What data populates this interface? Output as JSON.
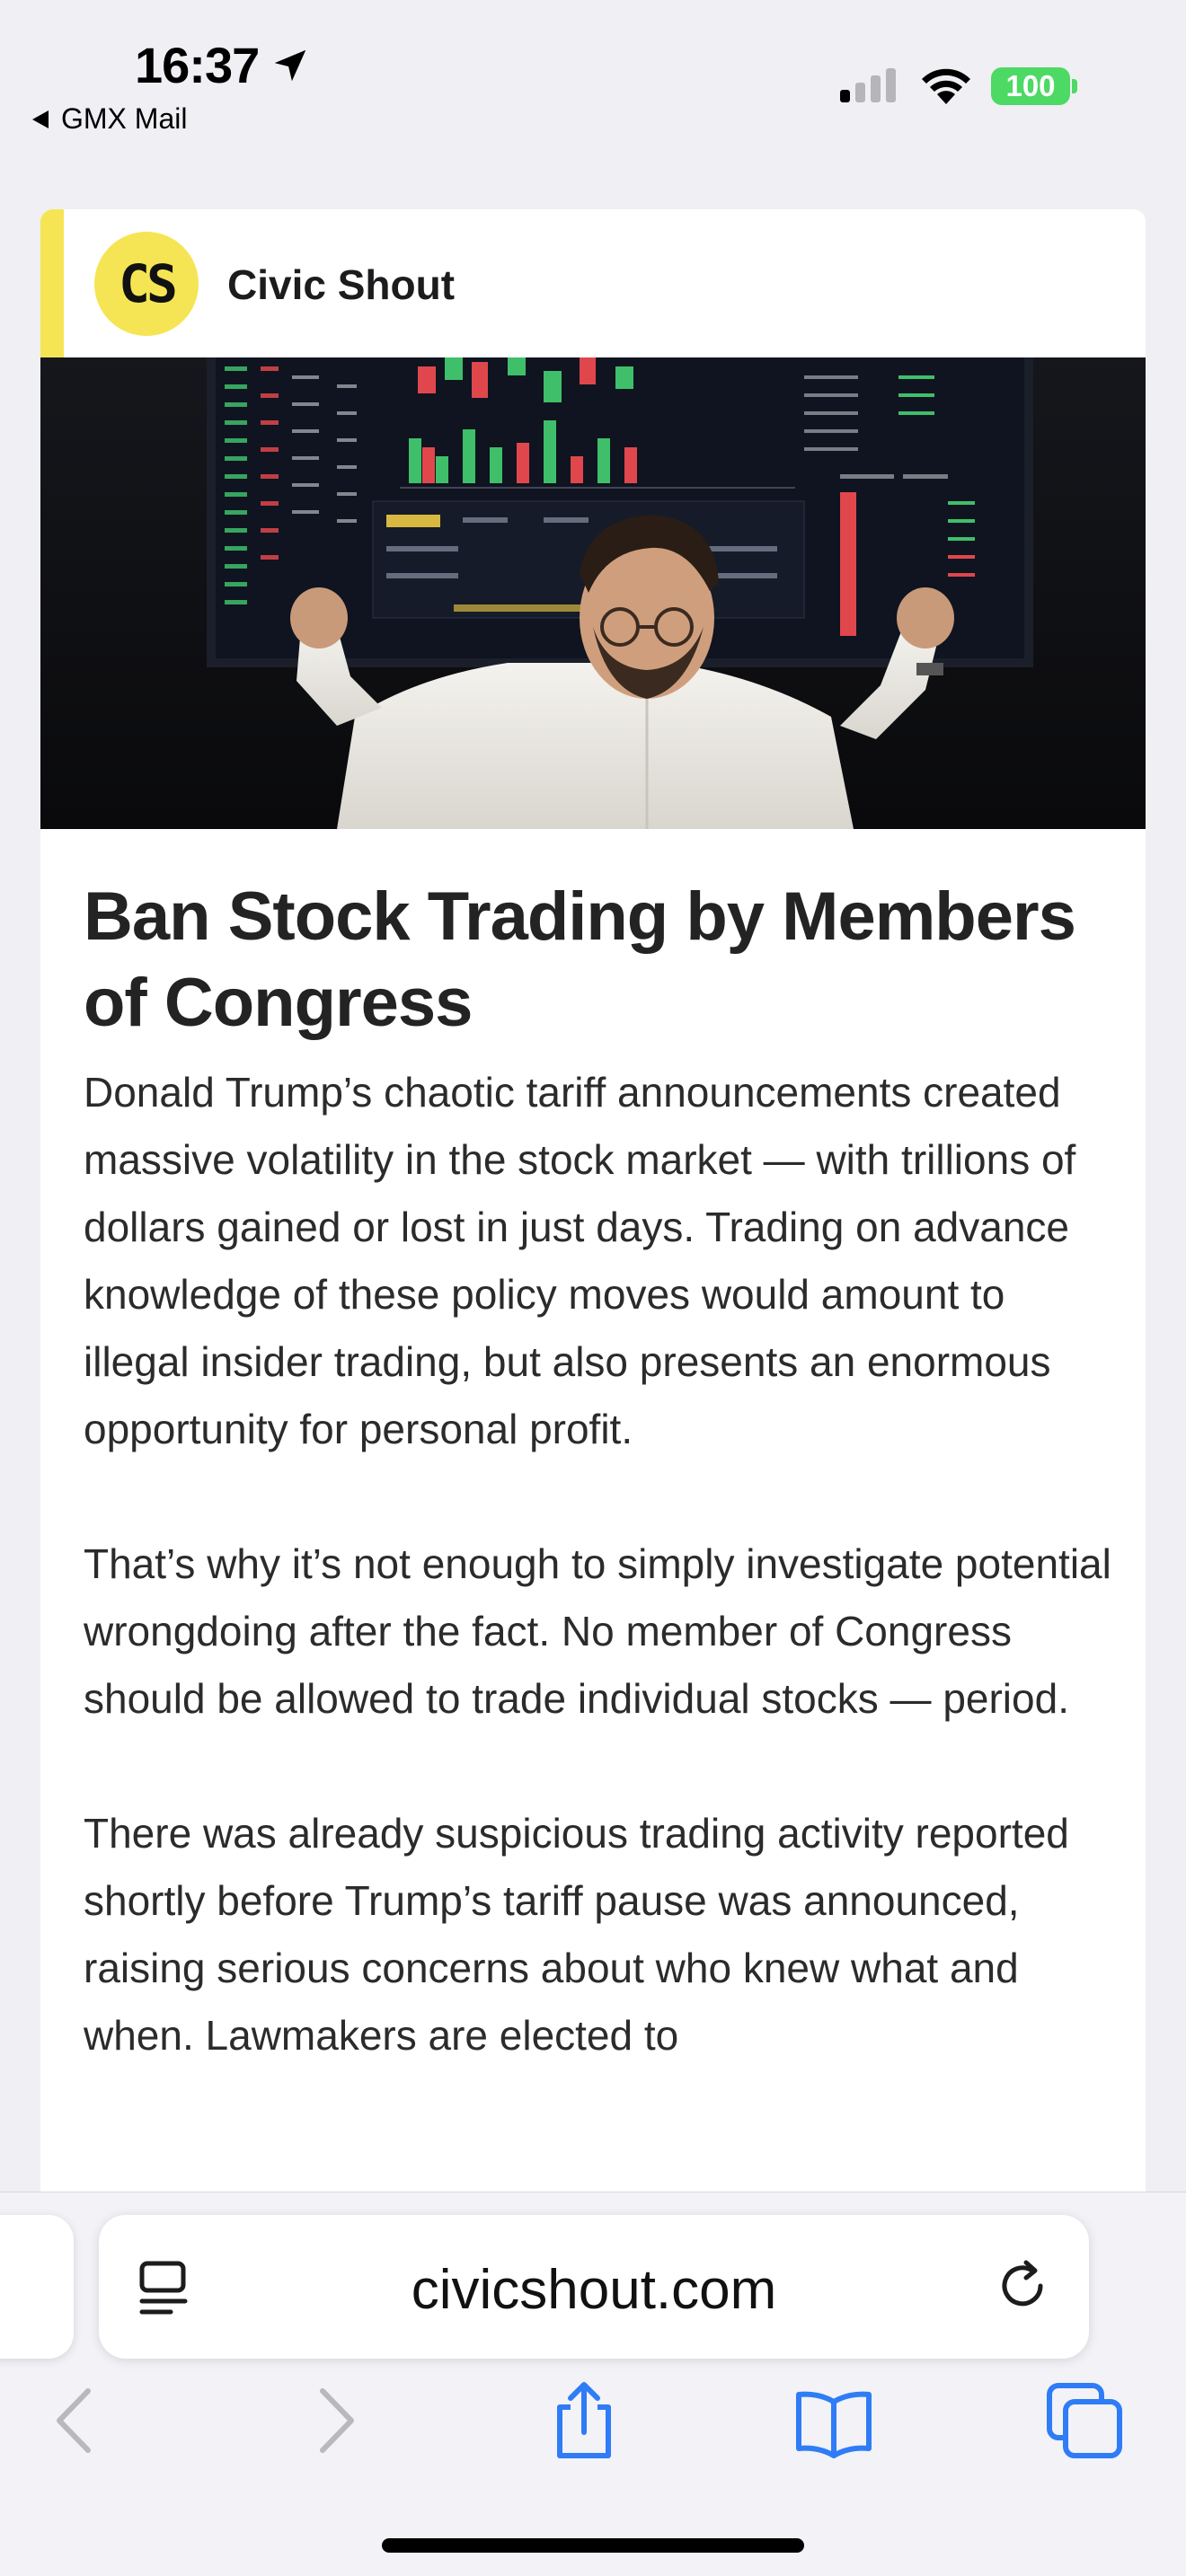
{
  "status_bar": {
    "time": "16:37",
    "back_app": "GMX Mail",
    "battery": "100",
    "battery_color": "#4cd964",
    "signal_bars_active": 1,
    "signal_bars_total": 4
  },
  "email": {
    "brand": {
      "logo_text": "CS",
      "name": "Civic Shout",
      "accent_color": "#f5e554"
    },
    "hero_image": {
      "icon": "photo-person-celebrating-stock-screen"
    },
    "headline": "Ban Stock Trading by Members of Congress",
    "paragraphs": [
      "Donald Trump’s chaotic tariff announcements created massive volatility in the stock market — with trillions of dollars gained or lost in just days. Trading on advance knowledge of these policy moves would amount to illegal insider trading, but also presents an enormous opportunity for personal profit.",
      "That’s why it’s not enough to simply investigate potential wrongdoing after the fact. No member of Congress should be allowed to trade individual stocks — period.",
      "There was already suspicious trading activity reported shortly before Trump’s tariff pause was announced, raising serious concerns about who knew what and when. Lawmakers are elected to"
    ]
  },
  "browser": {
    "url": "civicshout.com",
    "tint_color": "#2f7cf6",
    "toolbar": {
      "back": "chevron-left-icon",
      "forward": "chevron-right-icon",
      "share": "share-icon",
      "bookmarks": "book-icon",
      "tabs": "tabs-icon"
    }
  }
}
